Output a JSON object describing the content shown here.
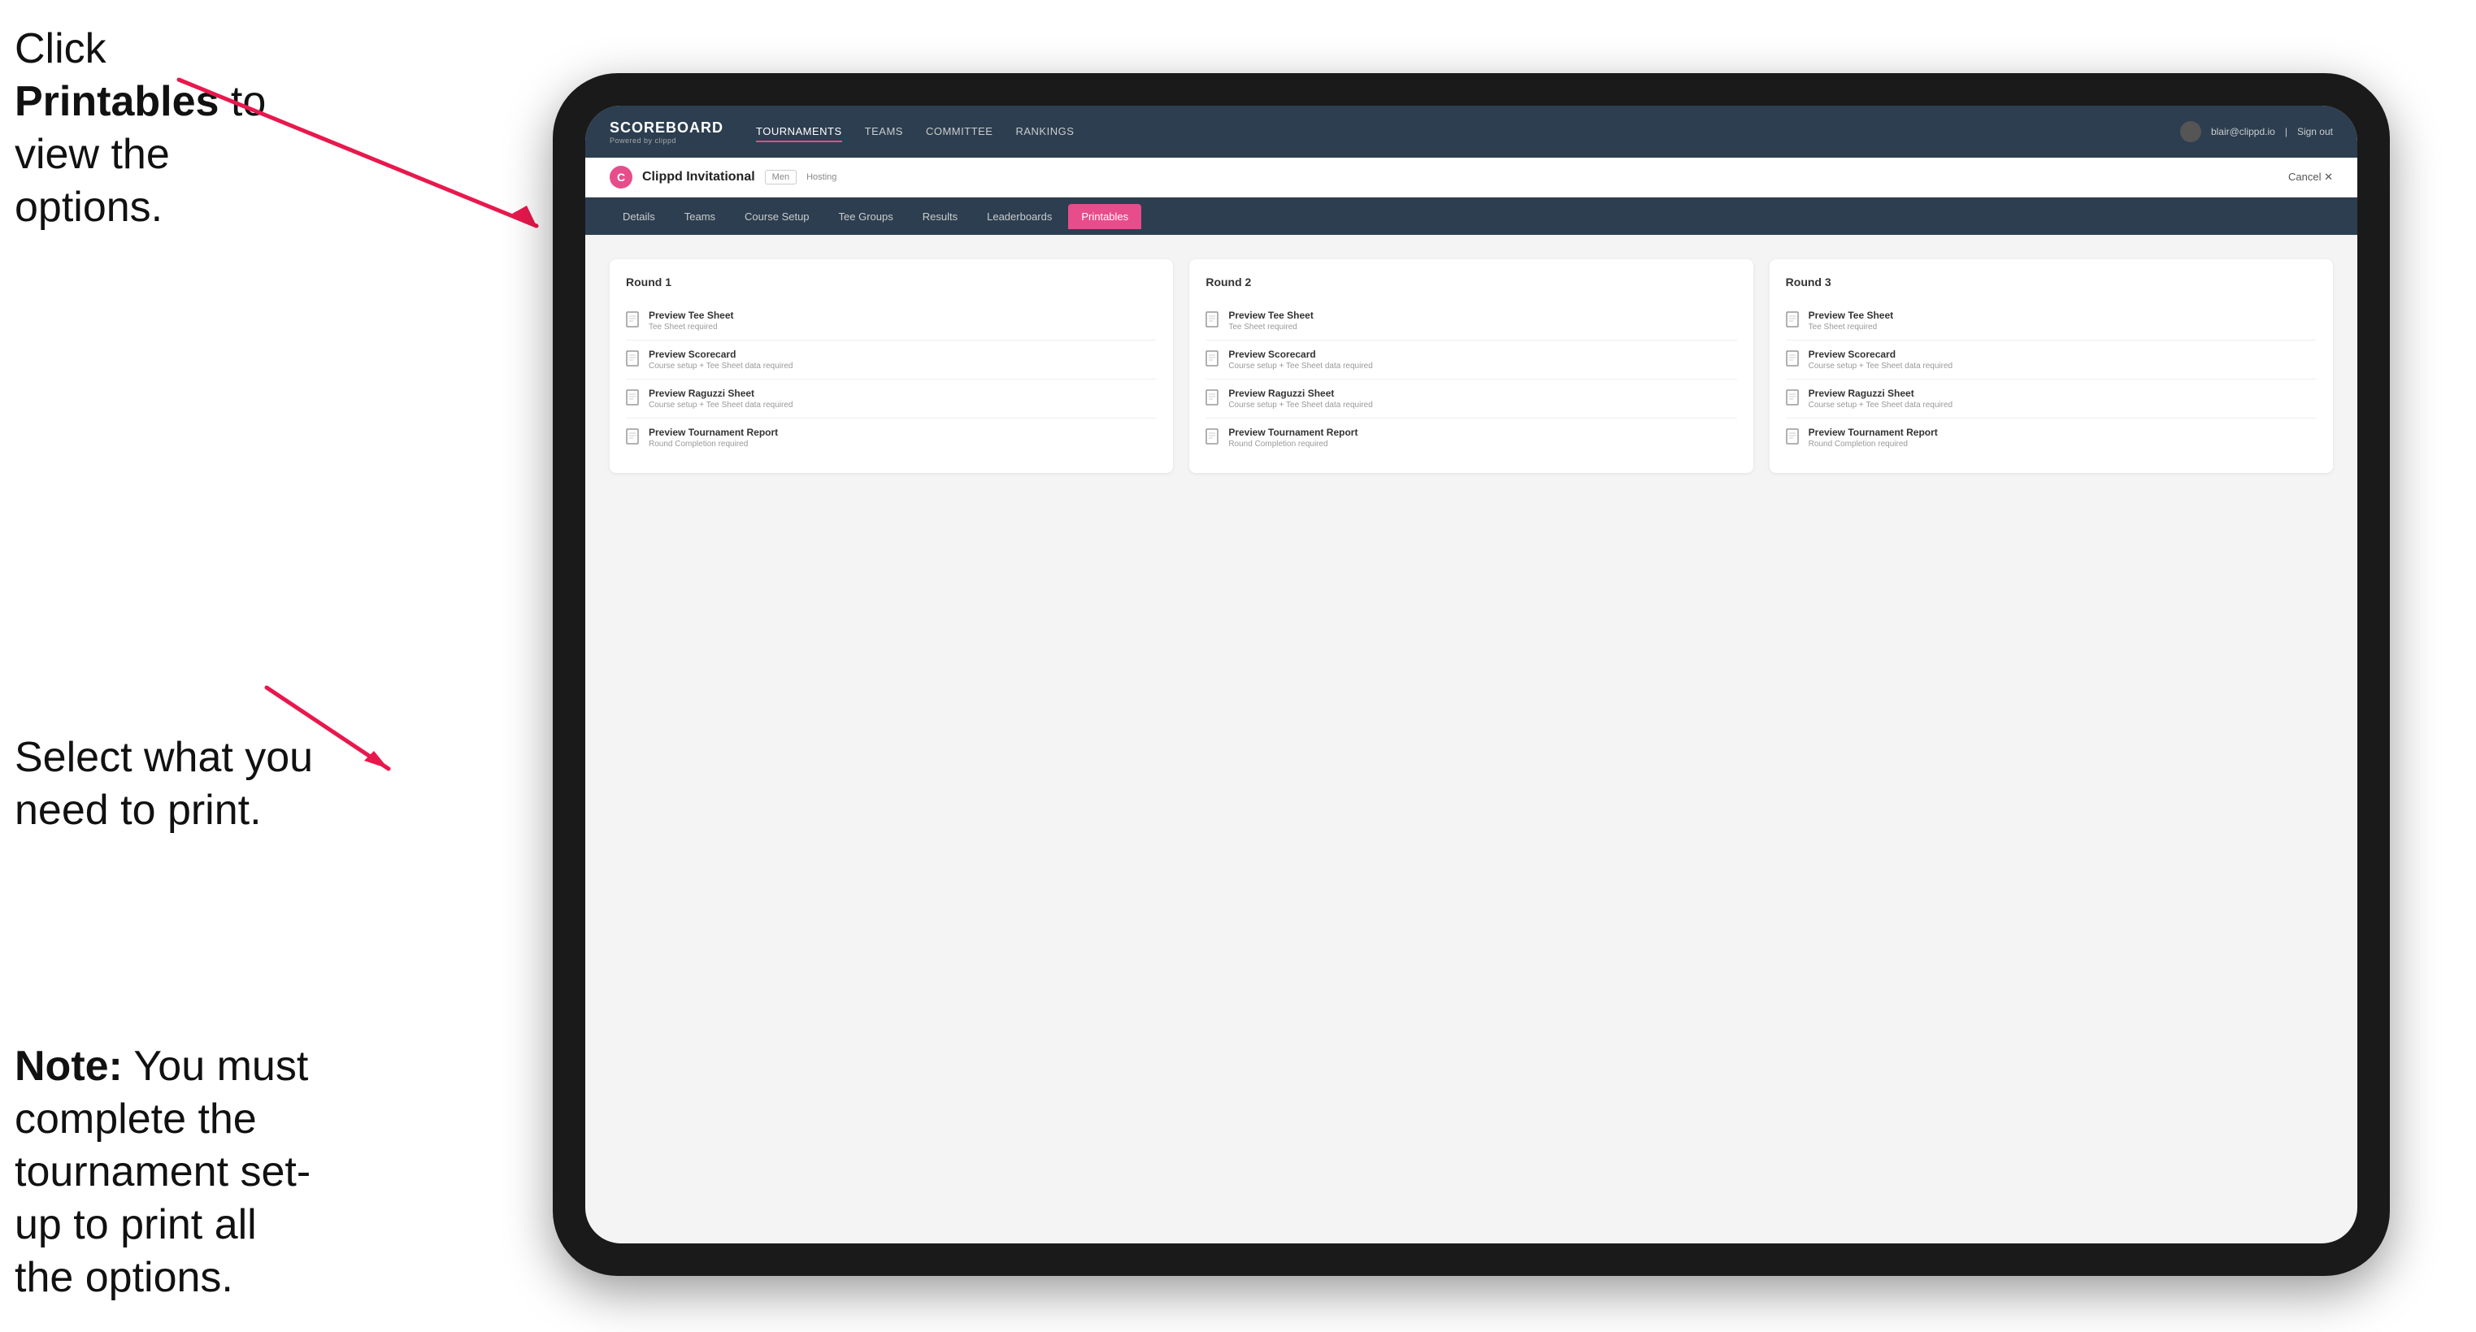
{
  "instructions": {
    "top": {
      "text_1": "Click ",
      "bold": "Printables",
      "text_2": " to\nview the options."
    },
    "middle": {
      "text": "Select what you\nneed to print."
    },
    "bottom": {
      "bold": "Note:",
      "text": " You must\ncomplete the\ntournament set-up\nto print all the options."
    }
  },
  "app": {
    "logo": {
      "title": "SCOREBOARD",
      "subtitle": "Powered by clippd"
    },
    "nav": [
      {
        "label": "TOURNAMENTS",
        "active": true
      },
      {
        "label": "TEAMS",
        "active": false
      },
      {
        "label": "COMMITTEE",
        "active": false
      },
      {
        "label": "RANKINGS",
        "active": false
      }
    ],
    "user": {
      "email": "blair@clippd.io",
      "sign_out": "Sign out"
    }
  },
  "tournament": {
    "name": "Clippd Invitational",
    "division": "Men",
    "status": "Hosting",
    "cancel": "Cancel"
  },
  "sub_nav": [
    {
      "label": "Details"
    },
    {
      "label": "Teams"
    },
    {
      "label": "Course Setup"
    },
    {
      "label": "Tee Groups"
    },
    {
      "label": "Results"
    },
    {
      "label": "Leaderboards"
    },
    {
      "label": "Printables",
      "active": true
    }
  ],
  "rounds": [
    {
      "title": "Round 1",
      "items": [
        {
          "title": "Preview Tee Sheet",
          "subtitle": "Tee Sheet required"
        },
        {
          "title": "Preview Scorecard",
          "subtitle": "Course setup + Tee Sheet data required"
        },
        {
          "title": "Preview Raguzzi Sheet",
          "subtitle": "Course setup + Tee Sheet data required"
        },
        {
          "title": "Preview Tournament Report",
          "subtitle": "Round Completion required"
        }
      ]
    },
    {
      "title": "Round 2",
      "items": [
        {
          "title": "Preview Tee Sheet",
          "subtitle": "Tee Sheet required"
        },
        {
          "title": "Preview Scorecard",
          "subtitle": "Course setup + Tee Sheet data required"
        },
        {
          "title": "Preview Raguzzi Sheet",
          "subtitle": "Course setup + Tee Sheet data required"
        },
        {
          "title": "Preview Tournament Report",
          "subtitle": "Round Completion required"
        }
      ]
    },
    {
      "title": "Round 3",
      "items": [
        {
          "title": "Preview Tee Sheet",
          "subtitle": "Tee Sheet required"
        },
        {
          "title": "Preview Scorecard",
          "subtitle": "Course setup + Tee Sheet data required"
        },
        {
          "title": "Preview Raguzzi Sheet",
          "subtitle": "Course setup + Tee Sheet data required"
        },
        {
          "title": "Preview Tournament Report",
          "subtitle": "Round Completion required"
        }
      ]
    }
  ]
}
